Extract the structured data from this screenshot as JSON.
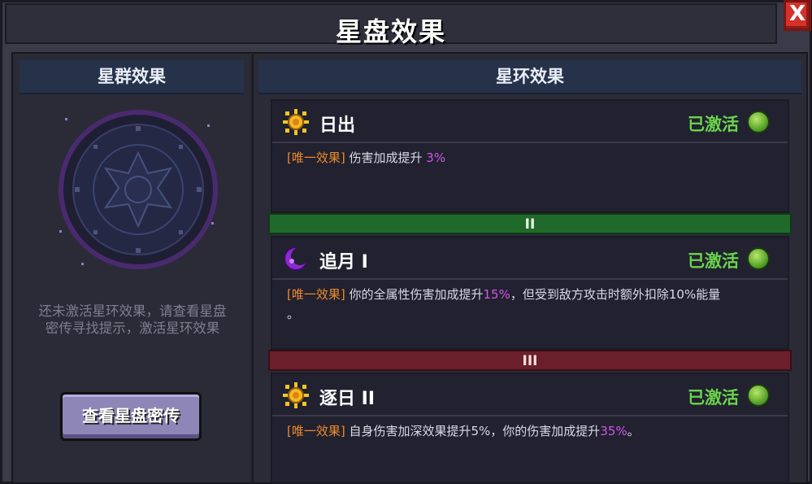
{
  "window": {
    "title": "星盘效果",
    "close_label": "X"
  },
  "left_panel": {
    "header": "星群效果",
    "hint_line1": "还未激活星环效果，请查看星盘",
    "hint_line2": "密传寻找提示，激活星环效果",
    "button_label": "查看星盘密传"
  },
  "right_panel": {
    "header": "星环效果",
    "tiers": [
      {
        "numeral": "II",
        "color": "#1f6a2a"
      },
      {
        "numeral": "III",
        "color": "#6a1f2a"
      }
    ],
    "cards": [
      {
        "name": "日出",
        "icon": "sun-icon",
        "status": "已激活",
        "tag": "[唯一效果]",
        "text_before": "伤害加成提升",
        "highlight": "3%",
        "text_after": "",
        "text_line2": ""
      },
      {
        "name": "追月 I",
        "icon": "moon-icon",
        "status": "已激活",
        "tag": "[唯一效果]",
        "text_before": "你的全属性伤害加成提升",
        "highlight": "15%",
        "text_after": "，但受到敌方攻击时额外扣除10%能量",
        "text_line2": "。"
      },
      {
        "name": "逐日 II",
        "icon": "sun-icon",
        "status": "已激活",
        "tag": "[唯一效果]",
        "text_before": "自身伤害加深效果提升5%，你的伤害加成提升",
        "highlight": "35%",
        "text_after": "。",
        "text_line2": ""
      }
    ]
  },
  "colors": {
    "active_green": "#6bd44a",
    "tag_orange": "#ee8a2a",
    "highlight_purple": "#d058e6"
  }
}
